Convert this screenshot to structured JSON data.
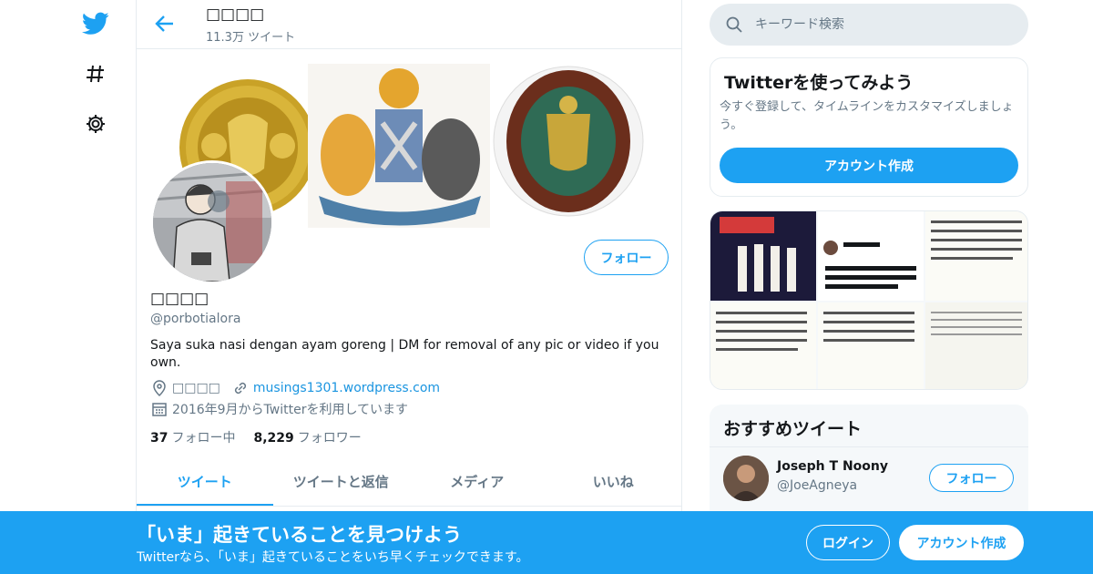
{
  "colors": {
    "accent": "#1da1f2",
    "text": "#14171a",
    "muted": "#657786",
    "border": "#e6ecf0"
  },
  "nav": {
    "icons": [
      "twitter-logo-icon",
      "hashtag-icon",
      "gear-icon"
    ]
  },
  "header": {
    "name": "□□□□",
    "tweet_count": "11.3万 ツイート"
  },
  "profile": {
    "name": "□□□□",
    "handle": "@porbotialora",
    "bio": "Saya suka nasi dengan ayam goreng | DM for removal of any pic or video if you own.",
    "location": "□□□□",
    "website": "musings1301.wordpress.com",
    "joined": "2016年9月からTwitterを利用しています",
    "following_count": "37",
    "following_label": "フォロー中",
    "followers_count": "8,229",
    "followers_label": "フォロワー",
    "follow_label": "フォロー"
  },
  "tabs": [
    {
      "label": "ツイート",
      "active": true
    },
    {
      "label": "ツイートと返信",
      "active": false
    },
    {
      "label": "メディア",
      "active": false
    },
    {
      "label": "いいね",
      "active": false
    }
  ],
  "search": {
    "placeholder": "キーワード検索"
  },
  "signup_card": {
    "title": "Twitterを使ってみよう",
    "description": "今すぐ登録して、タイムラインをカスタマイズしましょう。",
    "button": "アカウント作成"
  },
  "recommended": {
    "title": "おすすめツイート",
    "user_name": "Joseph T Noony",
    "user_handle": "@JoeAgneya",
    "follow_label": "フォロー"
  },
  "bottom_banner": {
    "title": "「いま」起きていることを見つけよう",
    "subtitle": "Twitterなら、「いま」起きていることをいち早くチェックできます。",
    "login": "ログイン",
    "signup": "アカウント作成"
  }
}
